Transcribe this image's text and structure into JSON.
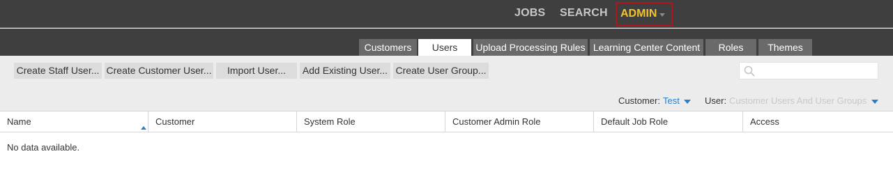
{
  "topnav": {
    "jobs_label": "JOBS",
    "search_label": "SEARCH",
    "admin_label": "ADMIN"
  },
  "tabs": [
    {
      "label": "Customers",
      "active": false
    },
    {
      "label": "Users",
      "active": true
    },
    {
      "label": "Upload Processing Rules",
      "active": false
    },
    {
      "label": "Learning Center Content",
      "active": false
    },
    {
      "label": "Roles",
      "active": false
    },
    {
      "label": "Themes",
      "active": false
    }
  ],
  "toolbar": {
    "buttons": [
      "Create Staff User...",
      "Create Customer User...",
      "Import User...",
      "Add Existing User...",
      "Create User Group..."
    ],
    "search_placeholder": ""
  },
  "filters": {
    "customer_label": "Customer:",
    "customer_value": "Test",
    "user_label": "User:",
    "user_value": "Customer Users And User Groups"
  },
  "table": {
    "columns": [
      "Name",
      "Customer",
      "System Role",
      "Customer Admin Role",
      "Default Job Role",
      "Access"
    ],
    "sorted_column": "Name",
    "sort_direction": "ascending",
    "empty_message": "No data available."
  },
  "colors": {
    "nav_bg": "#3f3f3f",
    "admin_active": "#f2c230",
    "admin_highlight_border": "#b0151a",
    "link_blue": "#2a7fc9",
    "tab_inactive": "#6a6a6a",
    "toolbar_bg": "#ececec"
  }
}
